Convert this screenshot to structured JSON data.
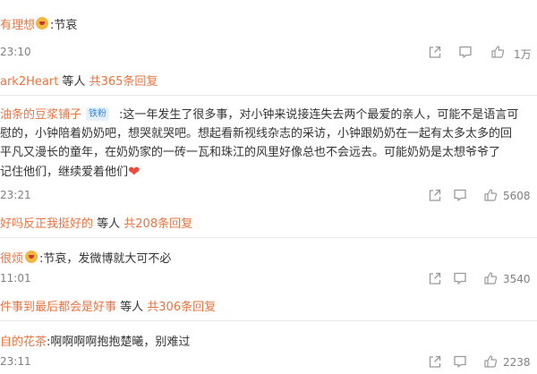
{
  "comments": [
    {
      "user": "有理想",
      "text": ":节哀",
      "time": "23:10",
      "likes": "1万"
    },
    {
      "reply_summary": {
        "user": "ark2Heart",
        "middle": " 等人 ",
        "count": "共365条回复"
      }
    },
    {
      "user": "油条的豆浆铺子",
      "badge": "铁粉",
      "lines": [
        ":这一年发生了很多事，对小钟来说接连失去两个最爱的亲人，可能不是语言可",
        "慰的，小钟陪着奶奶吧，想哭就哭吧。想起看新视线杂志的采访，小钟跟奶奶在一起有太多太多的回",
        "平凡又漫长的童年，在奶奶家的一砖一瓦和珠江的风里好像总也不会远去。可能奶奶是太想爷爷了",
        "记住他们，继续爱着他们"
      ],
      "time": "23:21",
      "likes": "5608"
    },
    {
      "reply_summary": {
        "user": "好吗反正我挺好的",
        "middle": " 等人 ",
        "count": "共208条回复"
      }
    },
    {
      "user": "很烦",
      "text": ":节哀，发微博就大可不必",
      "time": "11:01",
      "likes": "3540"
    },
    {
      "reply_summary": {
        "user": "件事到最后都会是好事",
        "middle": " 等人 ",
        "count": "共306条回复"
      }
    },
    {
      "user": "自的花茶",
      "text": ":啊啊啊啊抱抱楚曦，别难过",
      "time": "23:11",
      "likes": "2238"
    }
  ],
  "icons": {
    "share": "share-icon",
    "comment": "comment-icon",
    "like": "thumbs-up-icon",
    "heart": "red-heart-icon"
  },
  "colors": {
    "username": "#eb7340",
    "meta": "#808080",
    "badge_bg": "#e5f2fd",
    "badge_text": "#3a86d8"
  }
}
